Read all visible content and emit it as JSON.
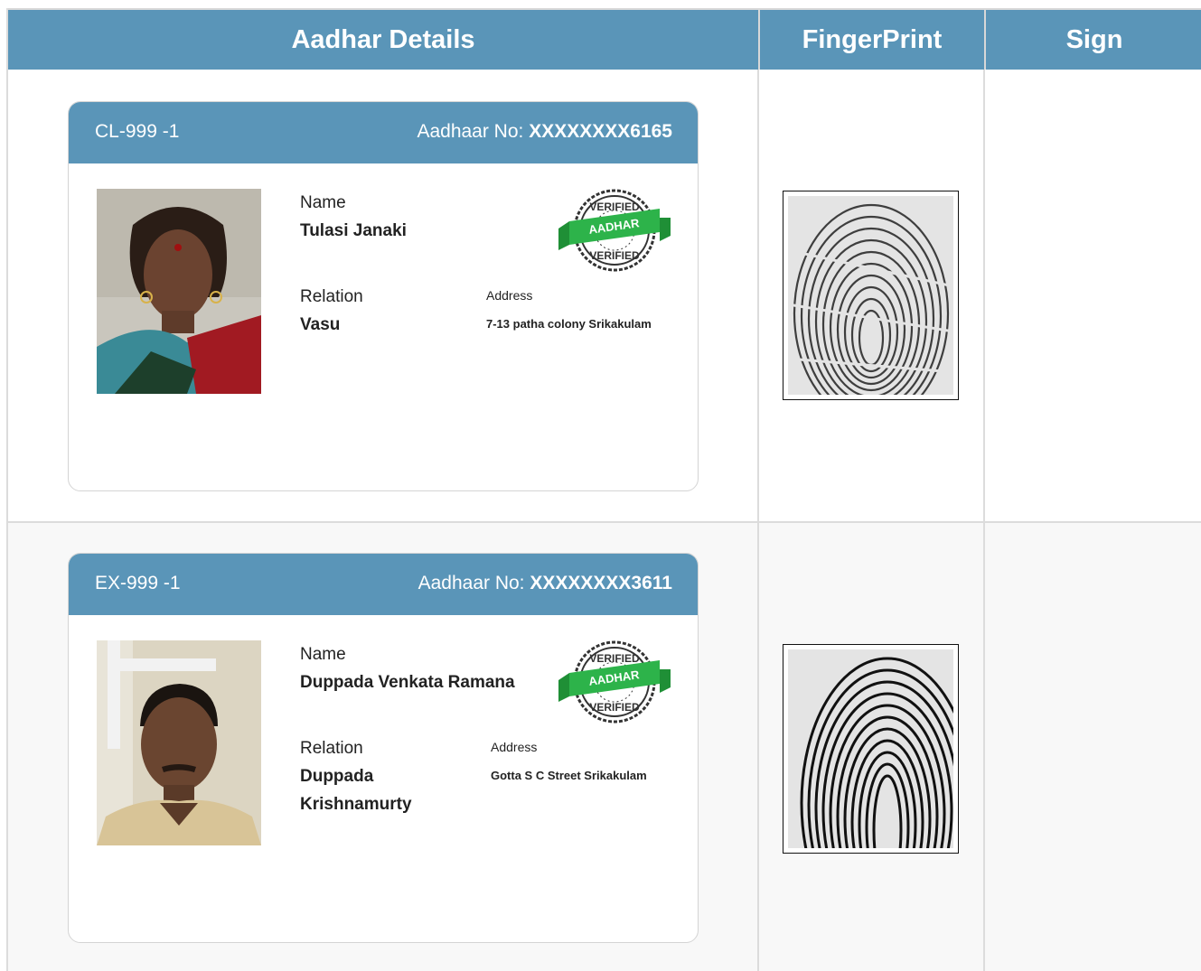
{
  "header": {
    "col1": "Aadhar Details",
    "col2": "FingerPrint",
    "col3": "Sign"
  },
  "records": [
    {
      "id": "CL-999 -1",
      "aadhaar_label": "Aadhaar No:",
      "aadhaar_no": "XXXXXXXX6165",
      "name_label": "Name",
      "name": "Tulasi Janaki",
      "relation_label": "Relation",
      "relation": "Vasu",
      "address_label": "Address",
      "address": "7-13 patha colony Srikakulam"
    },
    {
      "id": "EX-999 -1",
      "aadhaar_label": "Aadhaar No:",
      "aadhaar_no": "XXXXXXXX3611",
      "name_label": "Name",
      "name": "Duppada Venkata Ramana",
      "relation_label": "Relation",
      "relation_line1": "Duppada",
      "relation_line2": "Krishnamurty",
      "address_label": "Address",
      "address": "Gotta S C Street Srikakulam"
    }
  ],
  "seal": {
    "top_text": "VERIFIED",
    "ribbon_text": "AADHAR",
    "bottom_text": "VERIFIED",
    "ribbon_color": "#2db34a"
  },
  "colors": {
    "header_blue": "#5a95b8",
    "border": "#dcdcdc"
  }
}
